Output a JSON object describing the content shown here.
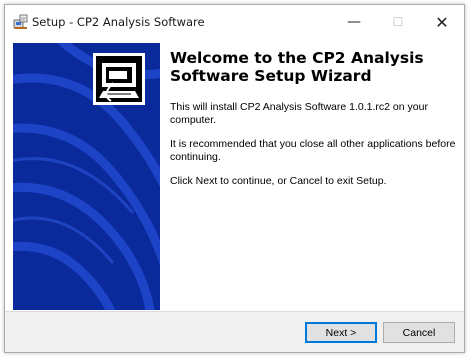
{
  "window": {
    "title": "Setup - CP2 Analysis Software",
    "controls": {
      "minimize": "—",
      "maximize": "☐",
      "close": "✕"
    }
  },
  "content": {
    "heading_line1": "Welcome to the CP2 Analysis",
    "heading_line2": "Software Setup Wizard",
    "paragraphs": [
      "This will install CP2 Analysis Software 1.0.1.rc2 on your computer.",
      "It is recommended that you close all other applications before continuing.",
      "Click Next to continue, or Cancel to exit Setup."
    ]
  },
  "buttons": {
    "next": "Next >",
    "cancel": "Cancel"
  },
  "colors": {
    "banner": "#0a2a9c",
    "banner_stroke": "#1d44c6",
    "accent": "#0078d7"
  },
  "icons": {
    "app": "setup-installer-icon",
    "banner": "computer-installer-icon"
  }
}
